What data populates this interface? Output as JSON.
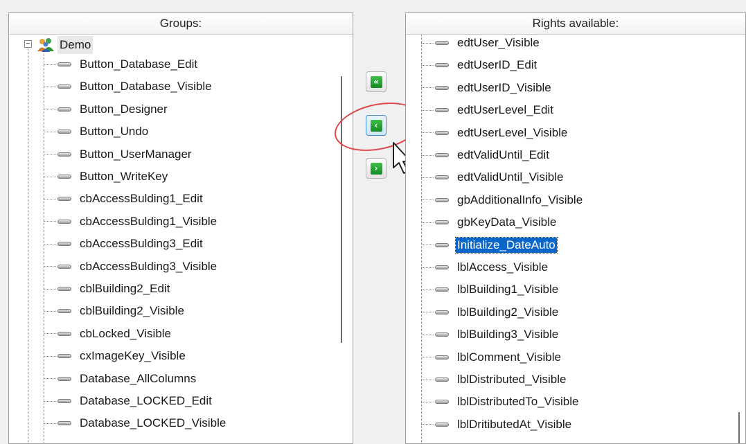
{
  "left_panel": {
    "header": "Groups:",
    "group_label": "Demo",
    "items": [
      "Button_Database_Edit",
      "Button_Database_Visible",
      "Button_Designer",
      "Button_Undo",
      "Button_UserManager",
      "Button_WriteKey",
      "cbAccessBulding1_Edit",
      "cbAccessBulding1_Visible",
      "cbAccessBulding3_Edit",
      "cbAccessBulding3_Visible",
      "cblBuilding2_Edit",
      "cblBuilding2_Visible",
      "cbLocked_Visible",
      "cxImageKey_Visible",
      "Database_AllColumns",
      "Database_LOCKED_Edit",
      "Database_LOCKED_Visible"
    ]
  },
  "right_panel": {
    "header": "Rights available:",
    "selected_index": 9,
    "items": [
      "edtUser_Visible",
      "edtUserID_Edit",
      "edtUserID_Visible",
      "edtUserLevel_Edit",
      "edtUserLevel_Visible",
      "edtValidUntil_Edit",
      "edtValidUntil_Visible",
      "gbAdditionalInfo_Visible",
      "gbKeyData_Visible",
      "Initialize_DateAuto",
      "lblAccess_Visible",
      "lblBuilding1_Visible",
      "lblBuilding2_Visible",
      "lblBuilding3_Visible",
      "lblComment_Visible",
      "lblDistributed_Visible",
      "lblDistributedTo_Visible",
      "lblDritibutedAt_Visible"
    ]
  },
  "buttons": {
    "move_all_left": "«",
    "move_left": "‹",
    "move_right": "›"
  },
  "colors": {
    "selection": "#0a66c8",
    "button_green": "#1f9e2e",
    "highlight_ring": "#e0454a"
  },
  "icons": {
    "group": "group-users-icon",
    "right": "right-item-icon",
    "expander": "collapse-minus-icon"
  }
}
